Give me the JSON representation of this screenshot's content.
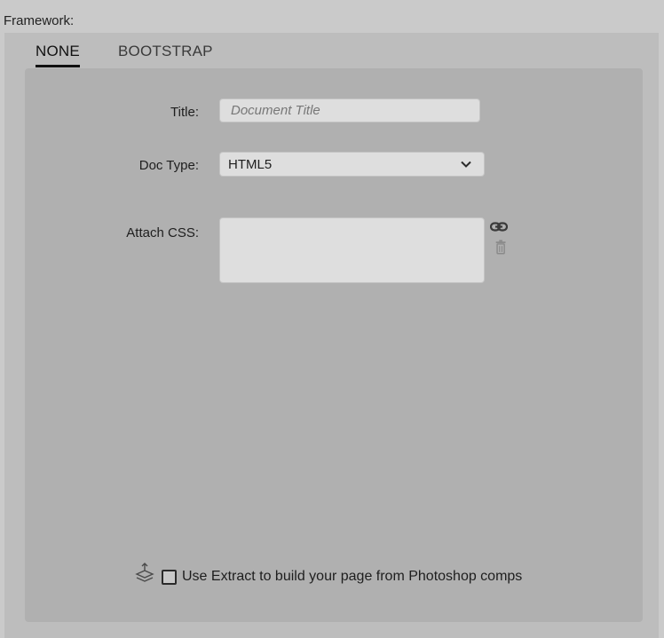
{
  "framework": {
    "label": "Framework:",
    "tabs": [
      {
        "label": "NONE",
        "active": true
      },
      {
        "label": "BOOTSTRAP",
        "active": false
      }
    ]
  },
  "form": {
    "title": {
      "label": "Title:",
      "value": "",
      "placeholder": "Document Title"
    },
    "doc_type": {
      "label": "Doc Type:",
      "selected": "HTML5",
      "icon": "chevron-down-icon"
    },
    "attach_css": {
      "label": "Attach CSS:",
      "files": [],
      "icons": [
        "link-icon",
        "trash-icon"
      ]
    }
  },
  "extract": {
    "label": "Use Extract to build your page from Photoshop comps",
    "checked": false,
    "icon": "layers-icon"
  },
  "colors": {
    "background": "#cacaca",
    "outer_panel": "#bdbdbd",
    "inner_panel": "#b0b0b0",
    "field": "#dedede"
  }
}
